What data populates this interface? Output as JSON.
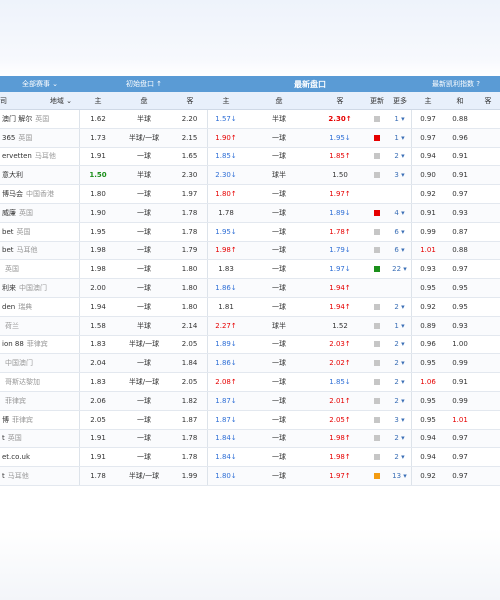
{
  "header_top": {
    "all_leagues": "全部赛事 ⌄",
    "initial_odds": "初始盘口 ↑",
    "latest_odds": "最新盘口",
    "kelly": "最新凯利指数 ?"
  },
  "header_cols": {
    "company": "司",
    "region": "地域 ⌄",
    "home": "主",
    "handicap": "盘",
    "away": "客",
    "latest_home": "主",
    "latest_handicap": "盘",
    "latest_away": "客",
    "update": "更新",
    "more": "更多",
    "kelly_home": "主",
    "kelly_draw": "和",
    "kelly_away": "客"
  },
  "colors": {
    "up": "#e60000",
    "down": "#2f6fd6",
    "green": "#1b8f1b",
    "header_blue": "#5a9bd5"
  },
  "rows": [
    {
      "company": "澳门 解尔",
      "region": "英国",
      "ih": "1.62",
      "ip": "半球",
      "ia": "2.20",
      "lh": "1.57↓",
      "lh_c": "blue",
      "lp": "半球",
      "la": "2.30↑",
      "la_c": "red",
      "la_b": true,
      "sq": "#c6c6c6",
      "more": "1 ▾",
      "kh": "0.97",
      "kh_c": "",
      "kd": "0.88",
      "kd_c": ""
    },
    {
      "company": "365",
      "region": "英国",
      "ih": "1.73",
      "ip": "半球/一球",
      "ia": "2.15",
      "lh": "1.90↑",
      "lh_c": "red",
      "lp": "一球",
      "la": "1.95↓",
      "la_c": "blue",
      "la_b": false,
      "sq": "#e60000",
      "more": "1 ▾",
      "kh": "0.97",
      "kh_c": "",
      "kd": "0.96",
      "kd_c": ""
    },
    {
      "company": "ervetten",
      "region": "马耳他",
      "ih": "1.91",
      "ip": "一球",
      "ia": "1.65",
      "lh": "1.85↓",
      "lh_c": "blue",
      "lp": "一球",
      "la": "1.85↑",
      "la_c": "red",
      "la_b": false,
      "sq": "#c6c6c6",
      "more": "2 ▾",
      "kh": "0.94",
      "kh_c": "",
      "kd": "0.91",
      "kd_c": ""
    },
    {
      "company": "意大利",
      "region": "",
      "ih": "1.50",
      "ih_c": "green",
      "ip": "半球",
      "ia": "2.30",
      "lh": "2.30↓",
      "lh_c": "blue",
      "lp": "球半",
      "la": "1.50",
      "la_c": "",
      "la_b": false,
      "sq": "#c6c6c6",
      "more": "3 ▾",
      "kh": "0.90",
      "kh_c": "",
      "kd": "0.91",
      "kd_c": ""
    },
    {
      "company": "博马会",
      "region": "中国香港",
      "ih": "1.80",
      "ip": "一球",
      "ia": "1.97",
      "lh": "1.80↑",
      "lh_c": "red",
      "lp": "一球",
      "la": "1.97↑",
      "la_c": "red",
      "la_b": false,
      "sq": "",
      "more": "",
      "kh": "0.92",
      "kh_c": "",
      "kd": "0.97",
      "kd_c": ""
    },
    {
      "company": "威廉",
      "region": "英国",
      "ih": "1.90",
      "ip": "一球",
      "ia": "1.78",
      "lh": "1.78",
      "lh_c": "",
      "lp": "一球",
      "la": "1.89↓",
      "la_c": "blue",
      "la_b": false,
      "sq": "#e60000",
      "more": "4 ▾",
      "kh": "0.91",
      "kh_c": "",
      "kd": "0.93",
      "kd_c": ""
    },
    {
      "company": "bet",
      "region": "英国",
      "ih": "1.95",
      "ip": "一球",
      "ia": "1.78",
      "lh": "1.95↓",
      "lh_c": "blue",
      "lp": "一球",
      "la": "1.78↑",
      "la_c": "red",
      "la_b": false,
      "sq": "#c6c6c6",
      "more": "6 ▾",
      "kh": "0.99",
      "kh_c": "",
      "kd": "0.87",
      "kd_c": ""
    },
    {
      "company": "bet",
      "region": "马耳他",
      "ih": "1.98",
      "ip": "一球",
      "ia": "1.79",
      "lh": "1.98↑",
      "lh_c": "red",
      "lp": "一球",
      "la": "1.79↓",
      "la_c": "blue",
      "la_b": false,
      "sq": "#c6c6c6",
      "more": "6 ▾",
      "kh": "1.01",
      "kh_c": "red",
      "kd": "0.88",
      "kd_c": ""
    },
    {
      "company": "",
      "region": "英国",
      "ih": "1.98",
      "ip": "一球",
      "ia": "1.80",
      "lh": "1.83",
      "lh_c": "",
      "lp": "一球",
      "la": "1.97↓",
      "la_c": "blue",
      "la_b": false,
      "sq": "#1b8f1b",
      "more": "22 ▾",
      "kh": "0.93",
      "kh_c": "",
      "kd": "0.97",
      "kd_c": ""
    },
    {
      "company": "利来",
      "region": "中国澳门",
      "ih": "2.00",
      "ip": "一球",
      "ia": "1.80",
      "lh": "1.86↓",
      "lh_c": "blue",
      "lp": "一球",
      "la": "1.94↑",
      "la_c": "red",
      "la_b": false,
      "sq": "",
      "more": "",
      "kh": "0.95",
      "kh_c": "",
      "kd": "0.95",
      "kd_c": ""
    },
    {
      "company": "den",
      "region": "瑞典",
      "ih": "1.94",
      "ip": "一球",
      "ia": "1.80",
      "lh": "1.81",
      "lh_c": "",
      "lp": "一球",
      "la": "1.94↑",
      "la_c": "red",
      "la_b": false,
      "sq": "#c6c6c6",
      "more": "2 ▾",
      "kh": "0.92",
      "kh_c": "",
      "kd": "0.95",
      "kd_c": ""
    },
    {
      "company": "",
      "region": "荷兰",
      "ih": "1.58",
      "ip": "半球",
      "ia": "2.14",
      "lh": "2.27↑",
      "lh_c": "red",
      "lp": "球半",
      "la": "1.52",
      "la_c": "",
      "la_b": false,
      "sq": "#c6c6c6",
      "more": "1 ▾",
      "kh": "0.89",
      "kh_c": "",
      "kd": "0.93",
      "kd_c": ""
    },
    {
      "company": "ion 88",
      "region": "菲律宾",
      "ih": "1.83",
      "ip": "半球/一球",
      "ia": "2.05",
      "lh": "1.89↓",
      "lh_c": "blue",
      "lp": "一球",
      "la": "2.03↑",
      "la_c": "red",
      "la_b": false,
      "sq": "#c6c6c6",
      "more": "2 ▾",
      "kh": "0.96",
      "kh_c": "",
      "kd": "1.00",
      "kd_c": ""
    },
    {
      "company": "",
      "region": "中国澳门",
      "ih": "2.04",
      "ip": "一球",
      "ia": "1.84",
      "lh": "1.86↓",
      "lh_c": "blue",
      "lp": "一球",
      "la": "2.02↑",
      "la_c": "red",
      "la_b": false,
      "sq": "#c6c6c6",
      "more": "2 ▾",
      "kh": "0.95",
      "kh_c": "",
      "kd": "0.99",
      "kd_c": ""
    },
    {
      "company": "",
      "region": "哥斯达黎加",
      "ih": "1.83",
      "ip": "半球/一球",
      "ia": "2.05",
      "lh": "2.08↑",
      "lh_c": "red",
      "lp": "一球",
      "la": "1.85↓",
      "la_c": "blue",
      "la_b": false,
      "sq": "#c6c6c6",
      "more": "2 ▾",
      "kh": "1.06",
      "kh_c": "red",
      "kd": "0.91",
      "kd_c": ""
    },
    {
      "company": "",
      "region": "菲律宾",
      "ih": "2.06",
      "ip": "一球",
      "ia": "1.82",
      "lh": "1.87↓",
      "lh_c": "blue",
      "lp": "一球",
      "la": "2.01↑",
      "la_c": "red",
      "la_b": false,
      "sq": "#c6c6c6",
      "more": "2 ▾",
      "kh": "0.95",
      "kh_c": "",
      "kd": "0.99",
      "kd_c": ""
    },
    {
      "company": "博",
      "region": "菲律宾",
      "ih": "2.05",
      "ip": "一球",
      "ia": "1.87",
      "lh": "1.87↓",
      "lh_c": "blue",
      "lp": "一球",
      "la": "2.05↑",
      "la_c": "red",
      "la_b": false,
      "sq": "#c6c6c6",
      "more": "3 ▾",
      "kh": "0.95",
      "kh_c": "",
      "kd": "1.01",
      "kd_c": "red"
    },
    {
      "company": "t",
      "region": "英国",
      "ih": "1.91",
      "ip": "一球",
      "ia": "1.78",
      "lh": "1.84↓",
      "lh_c": "blue",
      "lp": "一球",
      "la": "1.98↑",
      "la_c": "red",
      "la_b": false,
      "sq": "#c6c6c6",
      "more": "2 ▾",
      "kh": "0.94",
      "kh_c": "",
      "kd": "0.97",
      "kd_c": ""
    },
    {
      "company": "et.co.uk",
      "region": "",
      "ih": "1.91",
      "ip": "一球",
      "ia": "1.78",
      "lh": "1.84↓",
      "lh_c": "blue",
      "lp": "一球",
      "la": "1.98↑",
      "la_c": "red",
      "la_b": false,
      "sq": "#c6c6c6",
      "more": "2 ▾",
      "kh": "0.94",
      "kh_c": "",
      "kd": "0.97",
      "kd_c": ""
    },
    {
      "company": "t",
      "region": "马耳他",
      "ih": "1.78",
      "ip": "半球/一球",
      "ia": "1.99",
      "lh": "1.80↓",
      "lh_c": "blue",
      "lp": "一球",
      "la": "1.97↑",
      "la_c": "red",
      "la_b": false,
      "sq": "#f39c12",
      "more": "13 ▾",
      "kh": "0.92",
      "kh_c": "",
      "kd": "0.97",
      "kd_c": ""
    }
  ]
}
